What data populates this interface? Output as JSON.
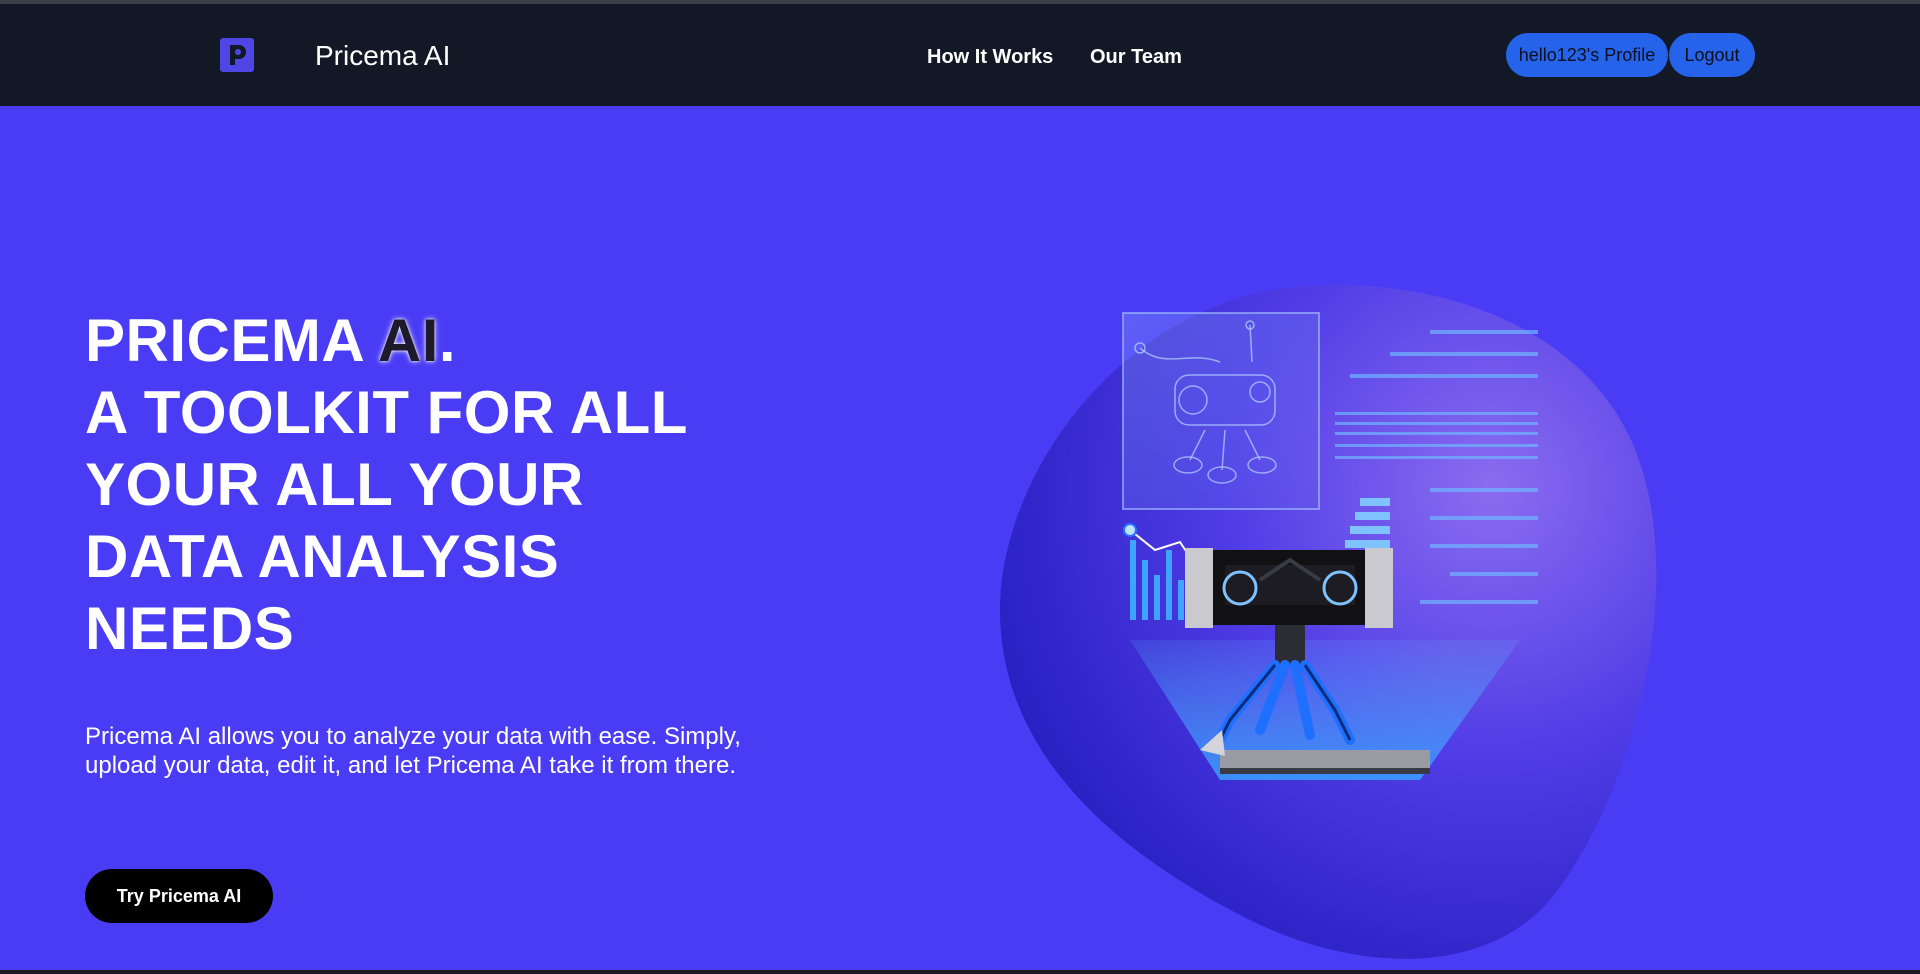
{
  "nav": {
    "brand": "Pricema AI",
    "logo_icon": "p-logo-icon",
    "links": [
      {
        "label": "How It Works"
      },
      {
        "label": "Our Team"
      }
    ],
    "profile_label": "hello123's Profile",
    "logout_label": "Logout"
  },
  "hero": {
    "title_word1": "PRICEMA",
    "title_ai": "AI",
    "title_dot": ".",
    "title_lines": [
      "A TOOLKIT FOR ALL",
      "YOUR ALL YOUR",
      "DATA ANALYSIS",
      "NEEDS"
    ],
    "description": "Pricema AI allows you to analyze your data with ease. Simply, upload your data, edit it, and let Pricema AI take it from there.",
    "cta_label": "Try Pricema AI",
    "illustration_icon": "robot-hologram-illustration"
  },
  "colors": {
    "navbar": "#121826",
    "hero_bg": "#4a3cf5",
    "button_blue": "#2563eb",
    "cta_bg": "#000000",
    "logo_bg": "#4f46e5"
  }
}
